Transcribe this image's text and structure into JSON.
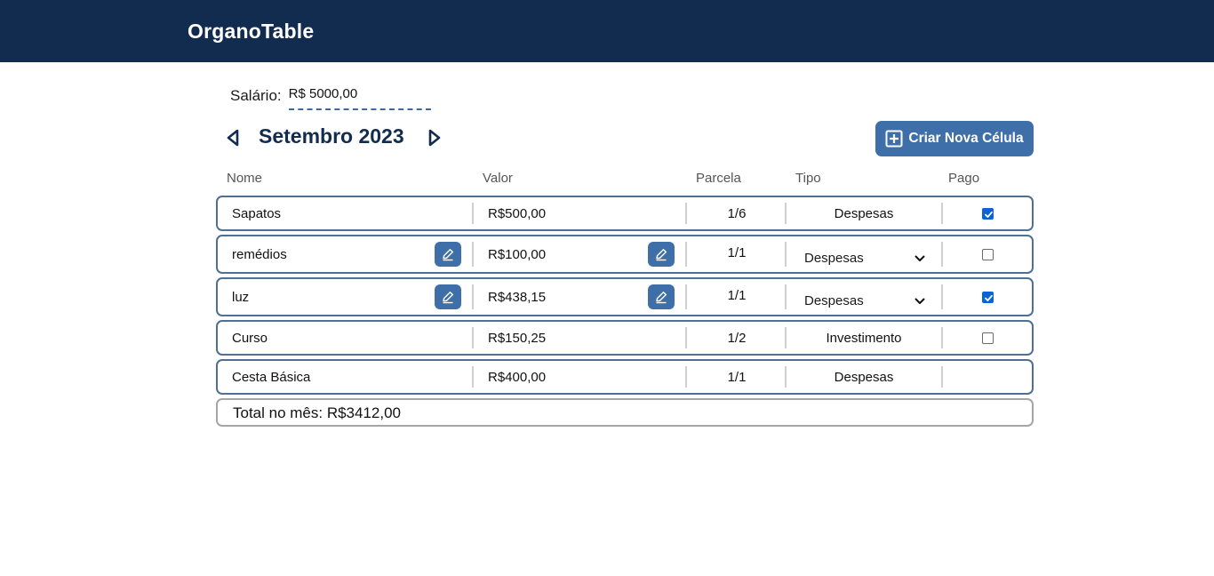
{
  "app": {
    "brand": "OrganoTable"
  },
  "salary": {
    "label": "Salário:",
    "value": "R$ 5000,00"
  },
  "month": {
    "title": "Setembro 2023",
    "prev_icon": "triangle-left-icon",
    "next_icon": "triangle-right-icon"
  },
  "new_button": {
    "label": "Criar Nova Célula",
    "icon": "plus-square-icon"
  },
  "columns": {
    "nome": "Nome",
    "valor": "Valor",
    "parcela": "Parcela",
    "tipo": "Tipo",
    "pago": "Pago"
  },
  "rows": [
    {
      "nome": "Sapatos",
      "valor": "R$500,00",
      "parcela": "1/6",
      "tipo": "Despesas",
      "pago": true,
      "editable": false
    },
    {
      "nome": "remédios",
      "valor": "R$100,00",
      "parcela": "1/1",
      "tipo": "Despesas",
      "pago": false,
      "editable": true
    },
    {
      "nome": "luz",
      "valor": "R$438,15",
      "parcela": "1/1",
      "tipo": "Despesas",
      "pago": true,
      "editable": true
    },
    {
      "nome": "Curso",
      "valor": "R$150,25",
      "parcela": "1/2",
      "tipo": "Investimento",
      "pago": false,
      "editable": false
    },
    {
      "nome": "Cesta Básica",
      "valor": "R$400,00",
      "parcela": "1/1",
      "tipo": "Despesas",
      "pago": null,
      "editable": false
    }
  ],
  "total": {
    "label": "Total no mês: R$3412,00"
  },
  "colors": {
    "header_bg": "#122c4f",
    "accent": "#3f6fa8",
    "row_border": "#4f6f94",
    "checkbox_on": "#0b63d6"
  }
}
